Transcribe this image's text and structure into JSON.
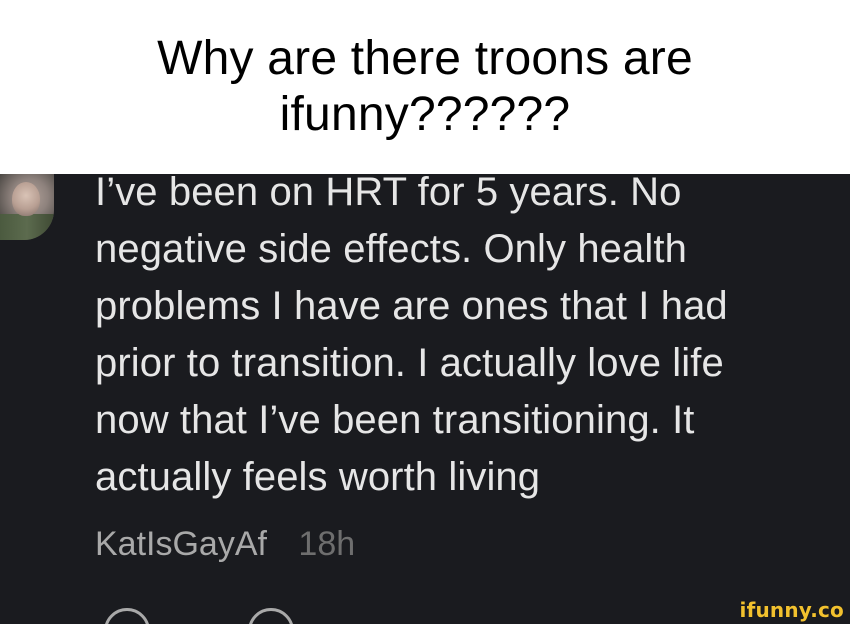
{
  "caption": {
    "lines": [
      "Why are there troons are",
      "ifunny??????"
    ]
  },
  "comment": {
    "lines": [
      "I’ve been on HRT for 5 years. No",
      "negative side effects. Only health",
      "problems I have are ones that I had",
      "prior to transition. I actually love life",
      "now that I’ve been transitioning. It",
      "actually feels worth living"
    ],
    "username": "KatIsGayAf",
    "time": "18h"
  },
  "branding": {
    "watermark": "ifunny.co",
    "watermark_color": "#f2c12e"
  },
  "colors": {
    "panel_bg": "#1a1b1f",
    "comment_text": "#e6e6e6",
    "username_text": "#a9a9a9",
    "time_text": "#6e6e6e"
  },
  "icons": {
    "avatar": "user-avatar",
    "action_left": "comment-action-icon",
    "action_right": "comment-action-icon"
  }
}
